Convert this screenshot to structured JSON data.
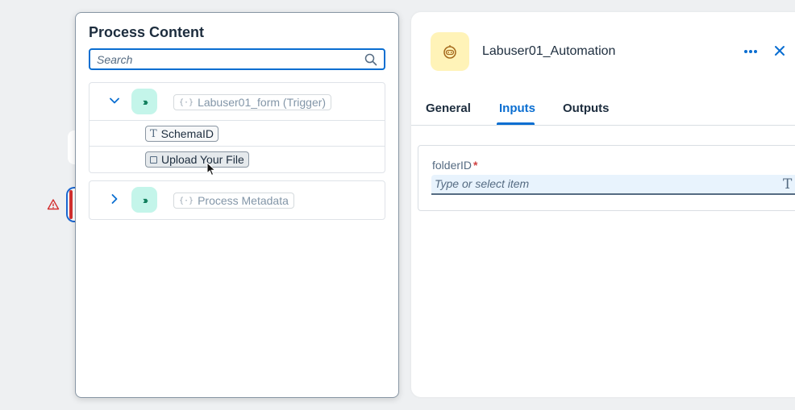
{
  "process_content": {
    "title": "Process Content",
    "search_placeholder": "Search",
    "groups": [
      {
        "label": "Labuser01_form (Trigger)",
        "expanded": true,
        "fields": [
          {
            "label": "SchemaID",
            "icon": "text-type-icon"
          },
          {
            "label": "Upload Your File",
            "icon": "file-type-icon"
          }
        ]
      },
      {
        "label": "Process Metadata",
        "expanded": false,
        "fields": []
      }
    ]
  },
  "side_panel": {
    "title": "Labuser01_Automation",
    "tabs": [
      {
        "label": "General",
        "active": false
      },
      {
        "label": "Inputs",
        "active": true
      },
      {
        "label": "Outputs",
        "active": false
      }
    ],
    "input_field": {
      "label": "folderID",
      "required_mark": "*",
      "placeholder": "Type or select item"
    }
  },
  "colors": {
    "accent": "#0a6ed1",
    "step_icon_bg": "#c4f5ea",
    "bot_avatar_bg": "#fff3b8",
    "error": "#d32f2f"
  }
}
